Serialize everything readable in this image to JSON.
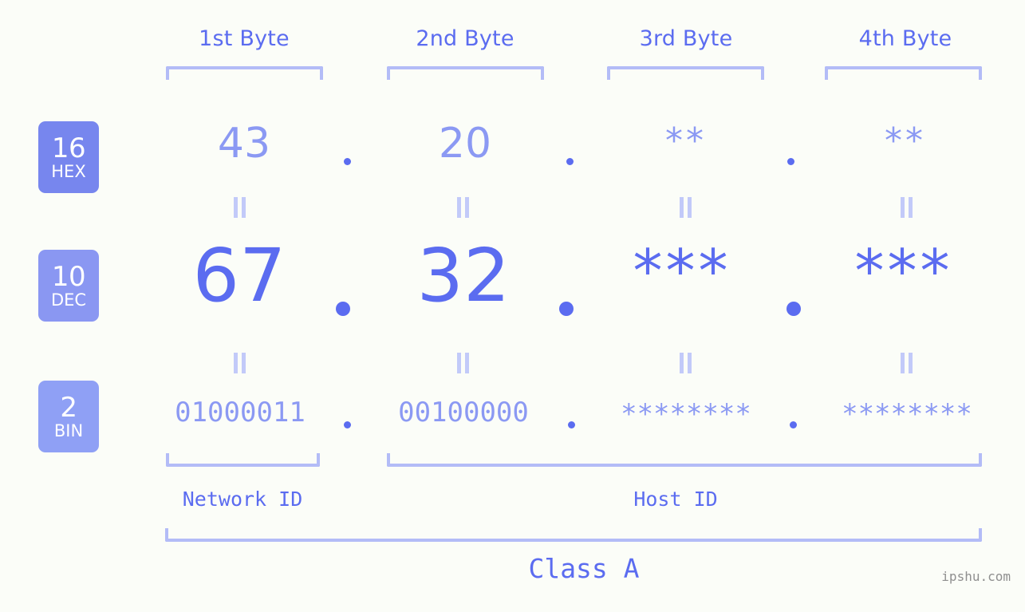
{
  "meta": {
    "background_color": "#fbfdf8",
    "accent_color": "#5b6cf0",
    "accent_light_color": "#8b99f3",
    "bracket_color": "#b3bcf7",
    "watermark": "ipshu.com"
  },
  "header": {
    "byte_labels": [
      "1st Byte",
      "2nd Byte",
      "3rd Byte",
      "4th Byte"
    ]
  },
  "radix_badges": [
    {
      "number": "16",
      "name": "HEX",
      "color": "#7786ee"
    },
    {
      "number": "10",
      "name": "DEC",
      "color": "#8a97f2"
    },
    {
      "number": "2",
      "name": "BIN",
      "color": "#8fa0f5"
    }
  ],
  "rows": {
    "hex": {
      "values": [
        "43",
        "20",
        "**",
        "**"
      ]
    },
    "dec": {
      "values": [
        "67",
        "32",
        "***",
        "***"
      ]
    },
    "bin": {
      "values": [
        "01000011",
        "00100000",
        "********",
        "********"
      ]
    }
  },
  "separators": {
    "hex": [
      ".",
      ".",
      "."
    ],
    "dec": [
      ".",
      ".",
      "."
    ],
    "bin": [
      ".",
      ".",
      "."
    ]
  },
  "equality_marks": {
    "hex_to_dec": [
      "=",
      "=",
      "=",
      "="
    ],
    "dec_to_bin": [
      "=",
      "=",
      "=",
      "="
    ]
  },
  "footer": {
    "network_id_label": "Network ID",
    "host_id_label": "Host ID",
    "class_label": "Class A"
  }
}
